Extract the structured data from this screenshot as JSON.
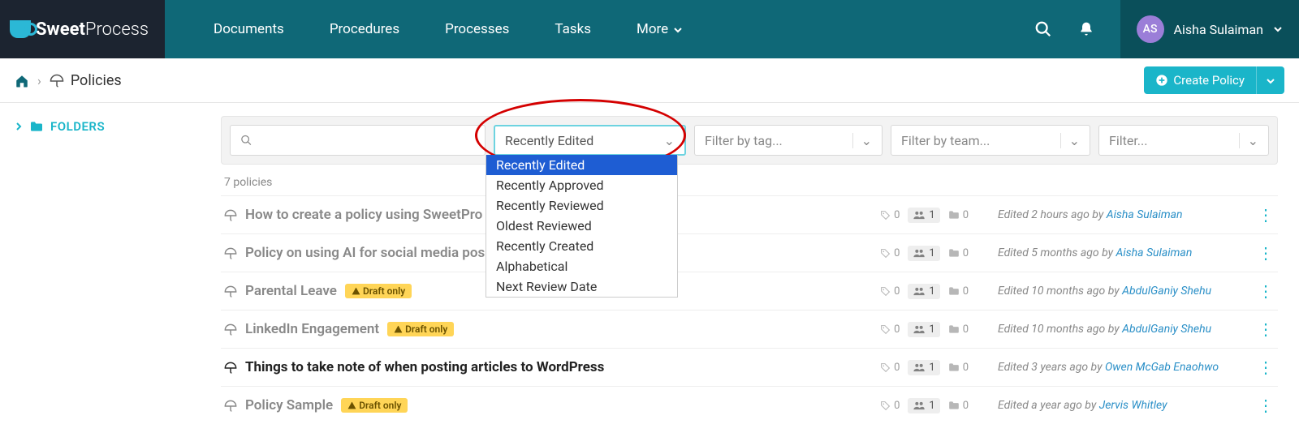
{
  "brand": {
    "part1": "Sweet",
    "part2": "Process"
  },
  "nav": {
    "documents": "Documents",
    "procedures": "Procedures",
    "processes": "Processes",
    "tasks": "Tasks",
    "more": "More"
  },
  "user": {
    "initials": "AS",
    "name": "Aisha Sulaiman"
  },
  "breadcrumb": {
    "title": "Policies"
  },
  "create_btn": "Create Policy",
  "sidebar": {
    "folders": "FOLDERS"
  },
  "filters": {
    "sort_placeholder": "Recently Edited",
    "tag_placeholder": "Filter by tag...",
    "team_placeholder": "Filter by team...",
    "filter_placeholder": "Filter..."
  },
  "sort_options": [
    "Recently Edited",
    "Recently Approved",
    "Recently Reviewed",
    "Oldest Reviewed",
    "Recently Created",
    "Alphabetical",
    "Next Review Date"
  ],
  "count_text": "7 policies",
  "draft_label": "Draft only",
  "policies": [
    {
      "title": "How to create a policy using SweetPro",
      "tags": "0",
      "users": "1",
      "folders": "0",
      "edited_prefix": "Edited 2 hours ago by ",
      "editor": "Aisha Sulaiman",
      "draft": false,
      "bold": false
    },
    {
      "title": "Policy on using AI for social media pos",
      "tags": "0",
      "users": "1",
      "folders": "0",
      "edited_prefix": "Edited 5 months ago by ",
      "editor": "Aisha Sulaiman",
      "draft": false,
      "bold": false
    },
    {
      "title": "Parental Leave",
      "tags": "0",
      "users": "1",
      "folders": "0",
      "edited_prefix": "Edited 10 months ago by ",
      "editor": "AbdulGaniy Shehu",
      "draft": true,
      "bold": false
    },
    {
      "title": "LinkedIn Engagement",
      "tags": "0",
      "users": "1",
      "folders": "0",
      "edited_prefix": "Edited 10 months ago by ",
      "editor": "AbdulGaniy Shehu",
      "draft": true,
      "bold": false
    },
    {
      "title": "Things to take note of when posting articles to WordPress",
      "tags": "0",
      "users": "1",
      "folders": "0",
      "edited_prefix": "Edited 3 years ago by ",
      "editor": "Owen McGab Enaohwo",
      "draft": false,
      "bold": true
    },
    {
      "title": "Policy Sample",
      "tags": "0",
      "users": "1",
      "folders": "0",
      "edited_prefix": "Edited a year ago by ",
      "editor": "Jervis Whitley",
      "draft": true,
      "bold": false
    }
  ]
}
